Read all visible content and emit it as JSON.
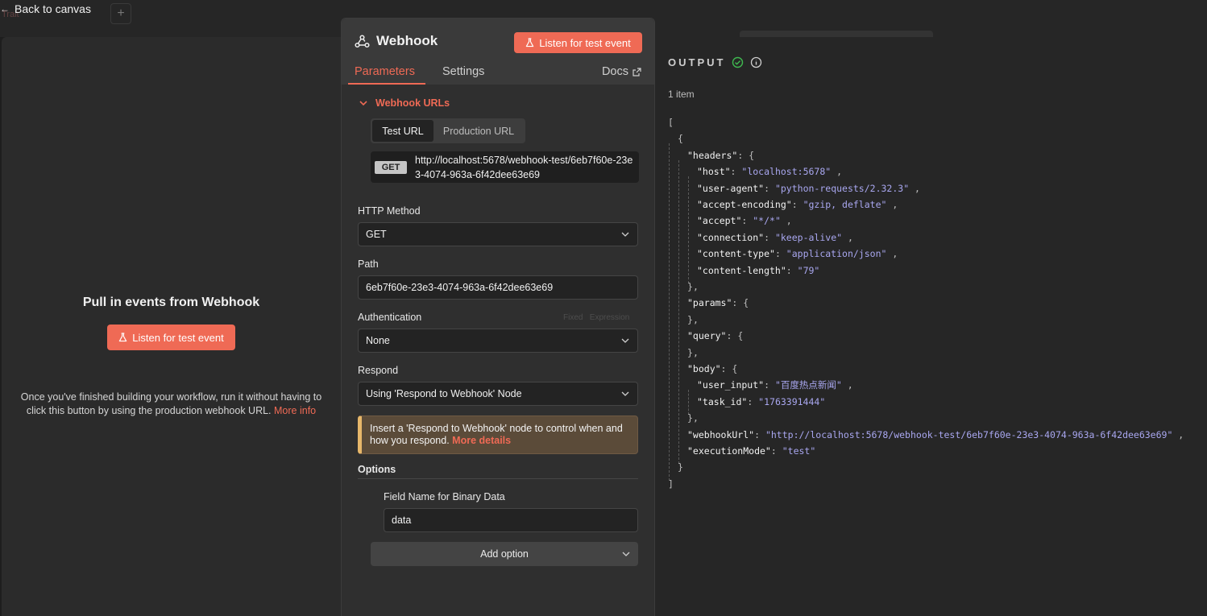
{
  "canvas": {
    "back_label": "Back to canvas",
    "ghost_tab": "Trait",
    "plus": "+"
  },
  "input_panel": {
    "title": "Pull in events from Webhook",
    "listen_button": "Listen for test event",
    "hint_text": "Once you've finished building your workflow, run it without having to click this button by using the production webhook URL.",
    "more_info": "More info"
  },
  "node": {
    "icon": "webhook-icon",
    "title": "Webhook",
    "listen_button": "Listen for test event",
    "tabs": [
      {
        "label": "Parameters",
        "active": true
      },
      {
        "label": "Settings",
        "active": false
      }
    ],
    "docs_label": "Docs",
    "webhook_urls": {
      "section_label": "Webhook URLs",
      "segments": [
        {
          "label": "Test URL",
          "active": true
        },
        {
          "label": "Production URL",
          "active": false
        }
      ],
      "method": "GET",
      "url": "http://localhost:5678/webhook-test/6eb7f60e-23e3-4074-963a-6f42dee63e69"
    },
    "http_method": {
      "label": "HTTP Method",
      "value": "GET"
    },
    "path": {
      "label": "Path",
      "value": "6eb7f60e-23e3-4074-963a-6f42dee63e69"
    },
    "authentication": {
      "label": "Authentication",
      "value": "None",
      "fixed": "Fixed",
      "expression": "Expression"
    },
    "respond": {
      "label": "Respond",
      "value": "Using 'Respond to Webhook' Node"
    },
    "notice": {
      "text": "Insert a 'Respond to Webhook' node to control when and how you respond.",
      "link": "More details",
      "accent_color": "#e7b76a"
    },
    "options": {
      "label": "Options",
      "binary_field_label": "Field Name for Binary Data",
      "binary_field_value": "data",
      "add_option": "Add option"
    }
  },
  "output": {
    "title": "OUTPUT",
    "items_count": "1 item",
    "status_color": "#3fb950",
    "json": {
      "headers": {
        "host": "localhost:5678",
        "user-agent": "python-requests/2.32.3",
        "accept-encoding": "gzip, deflate",
        "accept": "*/*",
        "connection": "keep-alive",
        "content-type": "application/json",
        "content-length": "79"
      },
      "params": {},
      "query": {},
      "body": {
        "user_input": "百度热点新闻",
        "task_id": "1763391444"
      },
      "webhookUrl": "http://localhost:5678/webhook-test/6eb7f60e-23e3-4074-963a-6f42dee63e69",
      "executionMode": "test"
    }
  },
  "colors": {
    "accent": "#ef6a55",
    "json_string": "#a9a7f0"
  }
}
